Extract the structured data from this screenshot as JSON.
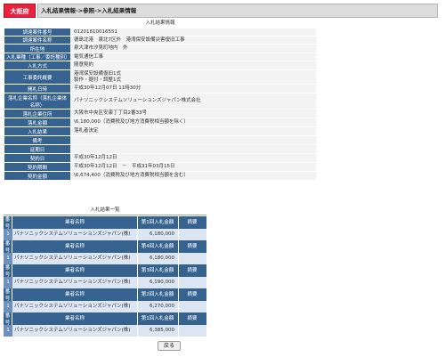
{
  "header": {
    "logo": "大阪府",
    "breadcrumb": "入札結果情報->参照->入札結果情報"
  },
  "info": {
    "title": "入札結果情報",
    "rows": [
      {
        "label": "調達案件番号",
        "lines": [
          "01201810016551"
        ]
      },
      {
        "label": "調達案件名称",
        "lines": [
          "德島北港　泉北7区外　港湾保安設備災害復旧工事"
        ]
      },
      {
        "label": "所在地",
        "lines": [
          "泉大津市汐見町地内　外"
        ]
      },
      {
        "label": "入札業種（工事／委託種別）",
        "lines": [
          "電気通信工事"
        ]
      },
      {
        "label": "入札方式",
        "lines": [
          "随意契約"
        ]
      },
      {
        "label": "工事委託概要",
        "lines": [
          "港湾保安設備復旧1式",
          "製作・据付・調整1式"
        ]
      },
      {
        "label": "開札日時",
        "lines": [
          "平成30年12月07日 11時30分"
        ]
      },
      {
        "label": "落札企業名称（落札企業体名称）",
        "lines": [
          "パナソニックシステムソリューションズジャパン株式会社"
        ]
      },
      {
        "label": "落札企業住所",
        "lines": [
          "大阪市中央区安康丁丁目2番33号"
        ]
      },
      {
        "label": "落札金額",
        "lines": [
          "\\6,180,000（消費税及び地方消費税相当額を除く）"
        ]
      },
      {
        "label": "入札結果",
        "lines": [
          "落札者決定"
        ]
      },
      {
        "label": "備考",
        "lines": [
          ""
        ]
      },
      {
        "label": "延期日",
        "lines": [
          ""
        ]
      },
      {
        "label": "契約日",
        "lines": [
          "平成30年12月12日"
        ]
      },
      {
        "label": "契約期間",
        "lines": [
          "平成30年12月12日　－　平成31年03月15日"
        ]
      },
      {
        "label": "契約金額",
        "lines": [
          "\\6,674,400（消費税及び地方消費税相当額を含む）"
        ]
      }
    ]
  },
  "results": {
    "title": "入札結果一覧",
    "no_header_top": "番",
    "no_header_bottom": "号",
    "col_bidder": "業者名称",
    "col_amount_prefix": "第",
    "col_amount_suffix": "回入札金額",
    "col_remarks": "摘要",
    "items": [
      {
        "no": "1",
        "round": "1",
        "bidder": "パナソニックシステムソリューションズジャパン(株)",
        "amount": "6,180,000",
        "remarks": ""
      },
      {
        "no": "1",
        "round": "4",
        "bidder": "パナソニックシステムソリューションズジャパン(株)",
        "amount": "6,180,000",
        "remarks": ""
      },
      {
        "no": "1",
        "round": "3",
        "bidder": "パナソニックシステムソリューションズジャパン(株)",
        "amount": "6,190,000",
        "remarks": ""
      },
      {
        "no": "1",
        "round": "2",
        "bidder": "パナソニックシステムソリューションズジャパン(株)",
        "amount": "6,270,000",
        "remarks": ""
      },
      {
        "no": "1",
        "round": "1",
        "bidder": "パナソニックシステムソリューションズジャパン(株)",
        "amount": "6,385,000",
        "remarks": ""
      }
    ]
  },
  "back_label": "戻る"
}
